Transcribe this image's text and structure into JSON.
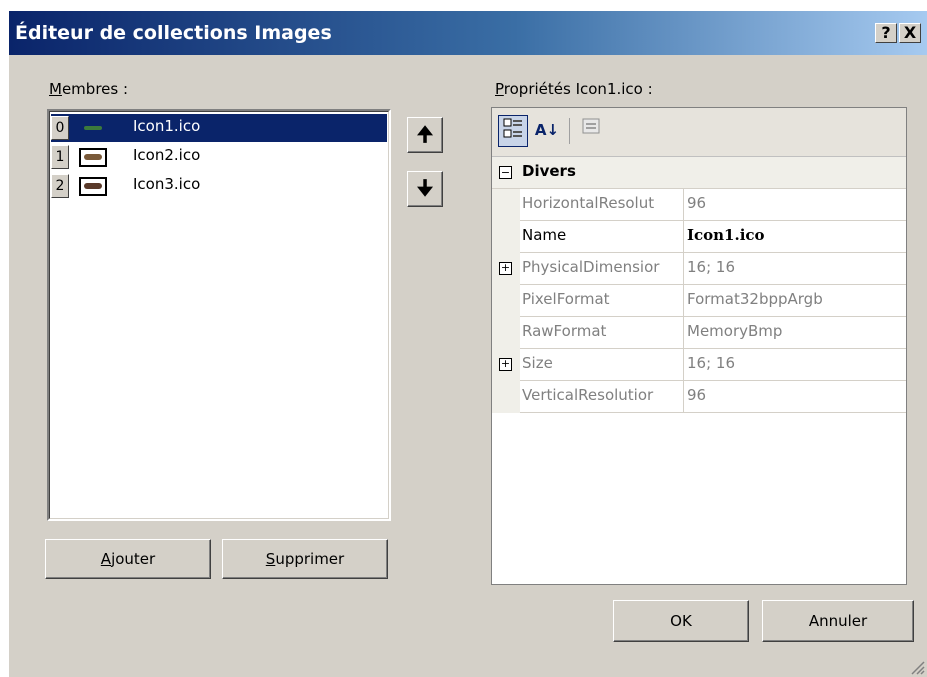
{
  "window": {
    "title": "Éditeur de collections Images",
    "help_label": "?",
    "close_label": "X"
  },
  "members": {
    "label_first": "M",
    "label_rest": "embres :",
    "items": [
      {
        "index": "0",
        "name": "Icon1.ico",
        "selected": true
      },
      {
        "index": "1",
        "name": "Icon2.ico",
        "selected": false
      },
      {
        "index": "2",
        "name": "Icon3.ico",
        "selected": false
      }
    ],
    "move_up_icon": "arrow-up-icon",
    "move_down_icon": "arrow-down-icon",
    "up_glyph": "🠉",
    "down_glyph": "🠋"
  },
  "buttons": {
    "add_first": "A",
    "add_rest": "jouter",
    "remove_first": "S",
    "remove_rest": "upprimer",
    "ok": "OK",
    "cancel": "Annuler"
  },
  "properties": {
    "label_first": "P",
    "label_rest": "ropriétés Icon1.ico :",
    "toolbar": {
      "categorized_icon": "categorized-icon",
      "alphabetical_icon": "sort-az-icon",
      "alphabetical_glyph": "A↓",
      "pages_icon": "property-pages-icon"
    },
    "category": {
      "expander": "⊟",
      "name": "Divers"
    },
    "rows": [
      {
        "name": "HorizontalResolut",
        "value": "96",
        "expander": ""
      },
      {
        "name": "Name",
        "value": "Icon1.ico",
        "expander": ""
      },
      {
        "name": "PhysicalDimensior",
        "value": "16; 16",
        "expander": "+"
      },
      {
        "name": "PixelFormat",
        "value": "Format32bppArgb",
        "expander": ""
      },
      {
        "name": "RawFormat",
        "value": "MemoryBmp",
        "expander": ""
      },
      {
        "name": "Size",
        "value": "16; 16",
        "expander": "+"
      },
      {
        "name": "VerticalResolutior",
        "value": "96",
        "expander": ""
      }
    ]
  }
}
